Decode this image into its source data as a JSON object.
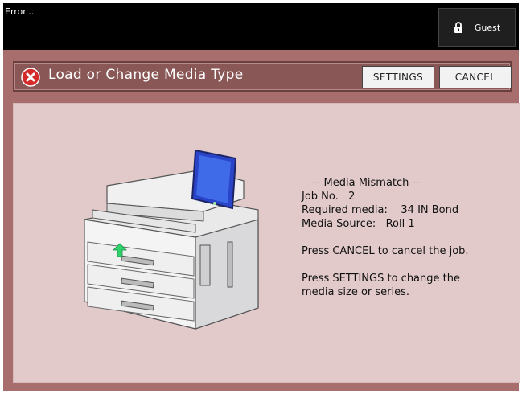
{
  "status_bar": {
    "text": "Error..."
  },
  "user": {
    "label": "Guest",
    "icon": "lock-icon"
  },
  "dialog": {
    "title": "Load or Change Media Type",
    "error_icon": "error-x-icon",
    "buttons": {
      "settings": "SETTINGS",
      "cancel": "CANCEL"
    },
    "message": {
      "heading": "-- Media Mismatch --",
      "job_no": "Job No.   2",
      "required_media": "Required media:    34 IN Bond",
      "media_source": "Media Source:   Roll 1",
      "cancel_hint": "Press CANCEL to cancel the job.",
      "settings_hint_1": "Press SETTINGS to change the",
      "settings_hint_2": "media size or series."
    },
    "illustration": "wide-format-printer-illustration"
  },
  "colors": {
    "main_bg": "#a86e6e",
    "header_bg": "#8a5757",
    "panel_bg": "#e3caca",
    "topbar_bg": "#000000",
    "error_red": "#d42a2a"
  }
}
